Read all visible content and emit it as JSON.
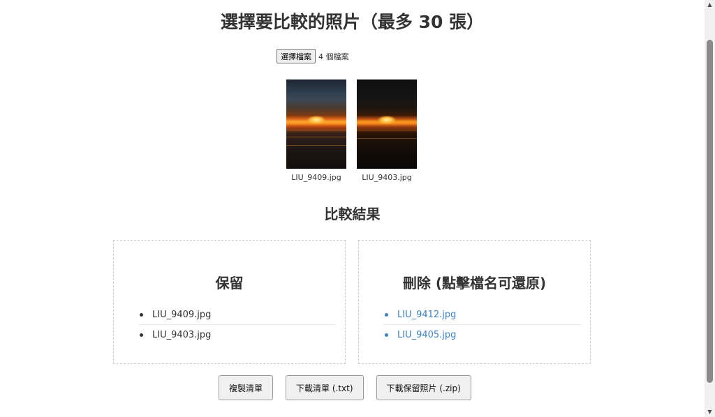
{
  "page": {
    "title": "選擇要比較的照片（最多 30 張）"
  },
  "file_input": {
    "button_label": "選擇檔案",
    "status": "4 個檔案"
  },
  "thumbnails": [
    {
      "filename": "LIU_9409.jpg"
    },
    {
      "filename": "LIU_9403.jpg"
    }
  ],
  "results": {
    "title": "比較結果",
    "keep": {
      "heading": "保留",
      "items": [
        "LIU_9409.jpg",
        "LIU_9403.jpg"
      ]
    },
    "delete": {
      "heading": "刪除 (點擊檔名可還原)",
      "items": [
        "LIU_9412.jpg",
        "LIU_9405.jpg"
      ]
    }
  },
  "actions": {
    "copy_list": "複製清單",
    "download_list": "下載清單 (.txt)",
    "download_zip": "下載保留照片 (.zip)"
  },
  "colors": {
    "link": "#3b82c4",
    "text": "#333333"
  },
  "scrollbar": {
    "up_icon": "scroll-up-arrow-icon",
    "down_icon": "scroll-down-arrow-icon"
  }
}
